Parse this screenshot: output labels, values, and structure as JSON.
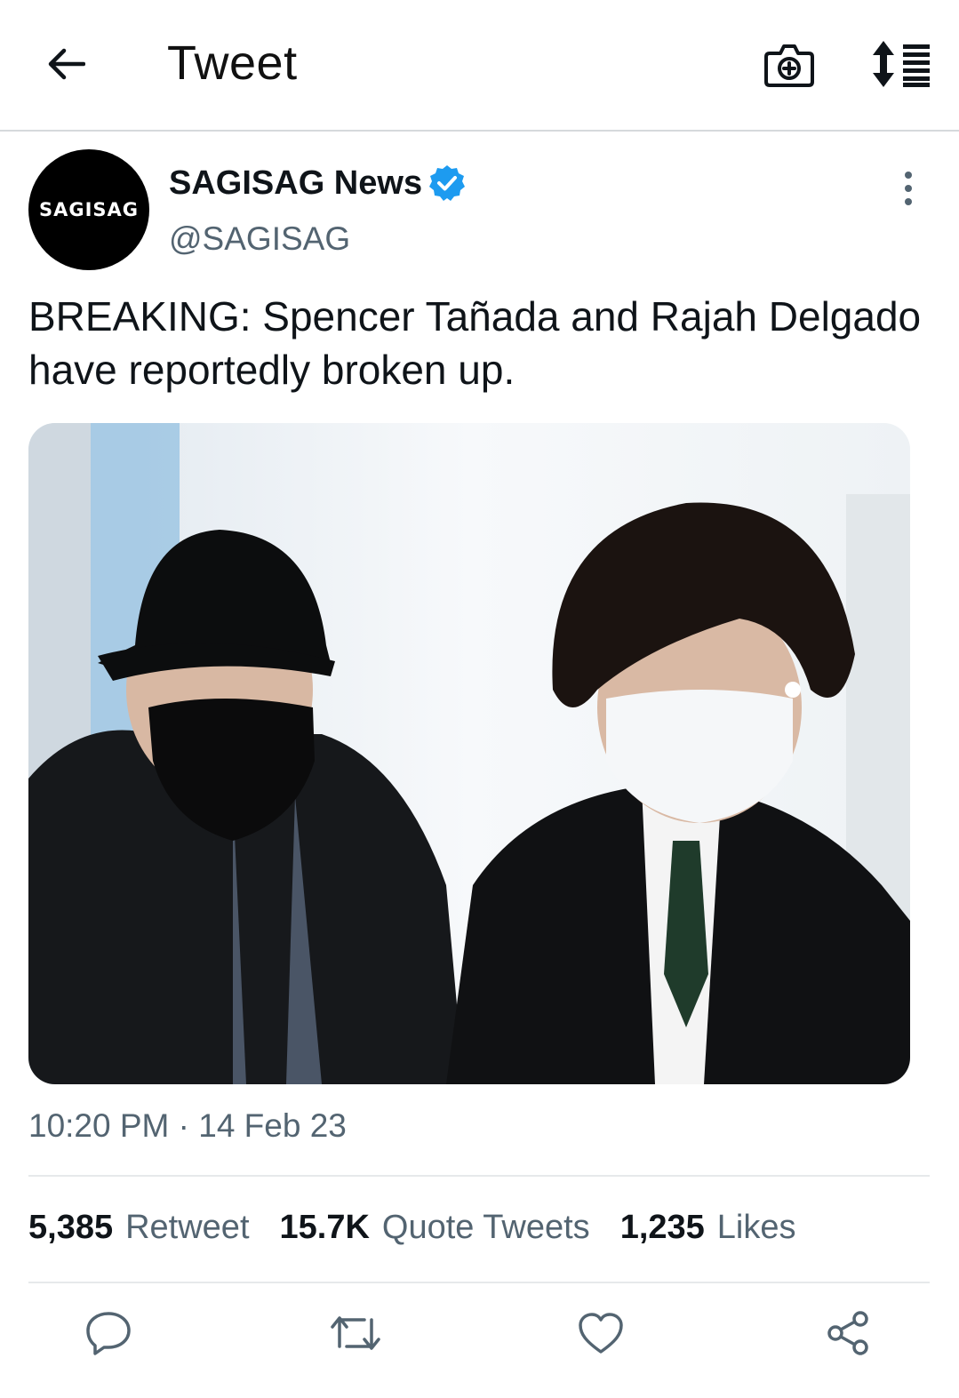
{
  "header": {
    "title": "Tweet",
    "back_icon": "arrow-left-icon",
    "camera_icon": "camera-plus-icon",
    "sort_icon": "sort-list-icon"
  },
  "author": {
    "avatar_text": "SAGISAG",
    "display_name": "SAGISAG News",
    "handle": "@SAGISAG",
    "verified": true,
    "verified_color": "#1d9bf0"
  },
  "tweet": {
    "text": "BREAKING: Spencer Tañada and Rajah Delgado have reportedly broken up.",
    "timestamp": "10:20 PM · 14 Feb 23"
  },
  "stats": [
    {
      "count": "5,385",
      "label": "Retweet"
    },
    {
      "count": "15.7K",
      "label": "Quote Tweets"
    },
    {
      "count": "1,235",
      "label": "Likes"
    }
  ],
  "actions": [
    {
      "icon": "reply-icon"
    },
    {
      "icon": "retweet-icon"
    },
    {
      "icon": "like-icon"
    },
    {
      "icon": "share-icon"
    }
  ],
  "colors": {
    "text_primary": "#0f1419",
    "text_secondary": "#536471",
    "divider": "#e6e9eb"
  }
}
